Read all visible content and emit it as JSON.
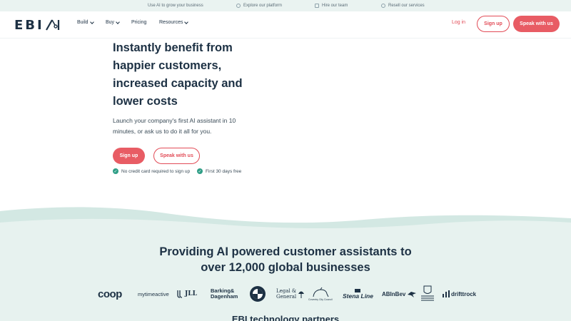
{
  "topbar": {
    "items": [
      {
        "label": "Use AI to grow your business",
        "icon": "none"
      },
      {
        "label": "Explore our platform",
        "icon": "circle-icon"
      },
      {
        "label": "Hire our team",
        "icon": "people-icon"
      },
      {
        "label": "Resell our services",
        "icon": "circle-icon"
      }
    ]
  },
  "nav": {
    "logo": "EBI",
    "links": [
      {
        "label": "Build",
        "has_dropdown": true
      },
      {
        "label": "Buy",
        "has_dropdown": true
      },
      {
        "label": "Pricing",
        "has_dropdown": false
      },
      {
        "label": "Resources",
        "has_dropdown": true
      }
    ],
    "login": "Log in",
    "signup": "Sign up",
    "speak": "Speak with us"
  },
  "hero": {
    "title_lines": [
      "Instantly benefit from",
      "happier customers,",
      "increased capacity and",
      "lower costs"
    ],
    "subtitle": "Launch your company's first AI assistant in 10 minutes, or ask us to do it all for you.",
    "signup": "Sign up",
    "speak": "Speak with us",
    "checks": [
      "No credit card required to sign up",
      "First 30 days free"
    ]
  },
  "customers": {
    "heading_line1": "Providing AI powered customer assistants to",
    "heading_line2": "over 12,000 global businesses",
    "logos": {
      "coop": "coop",
      "mytime": "mytimeactive",
      "jll": "JLL",
      "barking1": "Barking&",
      "barking2": "Dagenham",
      "legal1": "Legal &",
      "legal2": "General",
      "coventry": "Coventry City Council",
      "stena": "Stena Line",
      "abinbev": "ABInBev",
      "drifttrock": "drifttrock"
    },
    "partners_heading": "EBI technology partners"
  },
  "colors": {
    "accent": "#e85c64",
    "navy": "#1d3144",
    "teal": "#2f9e86",
    "mint": "#e7f2ef"
  }
}
